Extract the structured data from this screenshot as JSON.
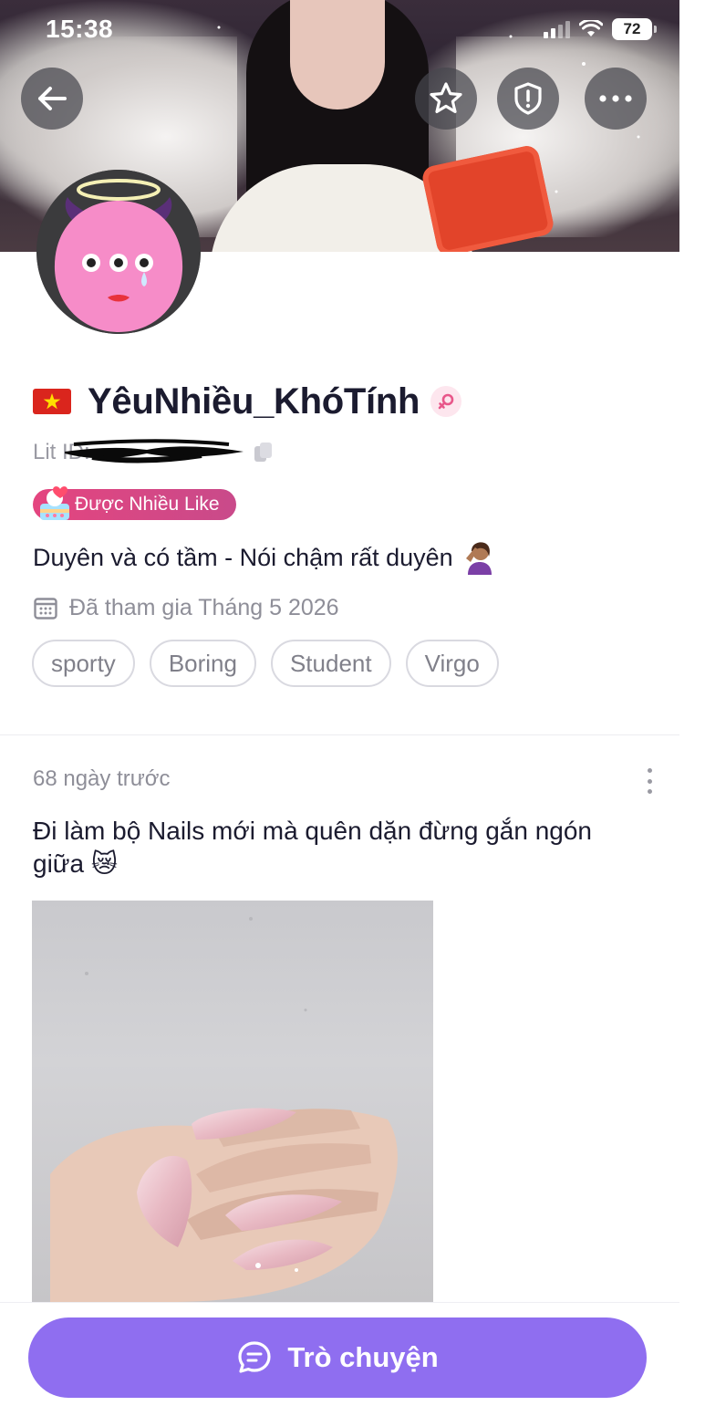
{
  "status_bar": {
    "time": "15:38",
    "battery": "72"
  },
  "header": {
    "back_icon": "arrow-left-icon",
    "favorite_icon": "star-icon",
    "report_icon": "shield-alert-icon",
    "more_icon": "more-horizontal-icon"
  },
  "profile": {
    "country_flag": "vietnam-flag",
    "name": "YêuNhiều_KhóTính",
    "gender_icon": "female-icon",
    "gender_color": "#e8578a",
    "lit_id_label": "Lit ID:",
    "badge_label": "Được Nhiều Like",
    "bio": "Duyên và có tầm - Nói chậm rất duyên",
    "bio_emoji": "🤦🏽‍♀️",
    "joined": "Đã tham gia Tháng 5 2026",
    "tags": [
      "sporty",
      "Boring",
      "Student",
      "Virgo"
    ]
  },
  "post": {
    "time": "68 ngày trước",
    "text": "Đi làm bộ Nails mới mà quên dặn đừng gắn ngón giữa 😿"
  },
  "bottom": {
    "chat_label": "Trò chuyện",
    "chat_color": "#8f6ef0"
  }
}
